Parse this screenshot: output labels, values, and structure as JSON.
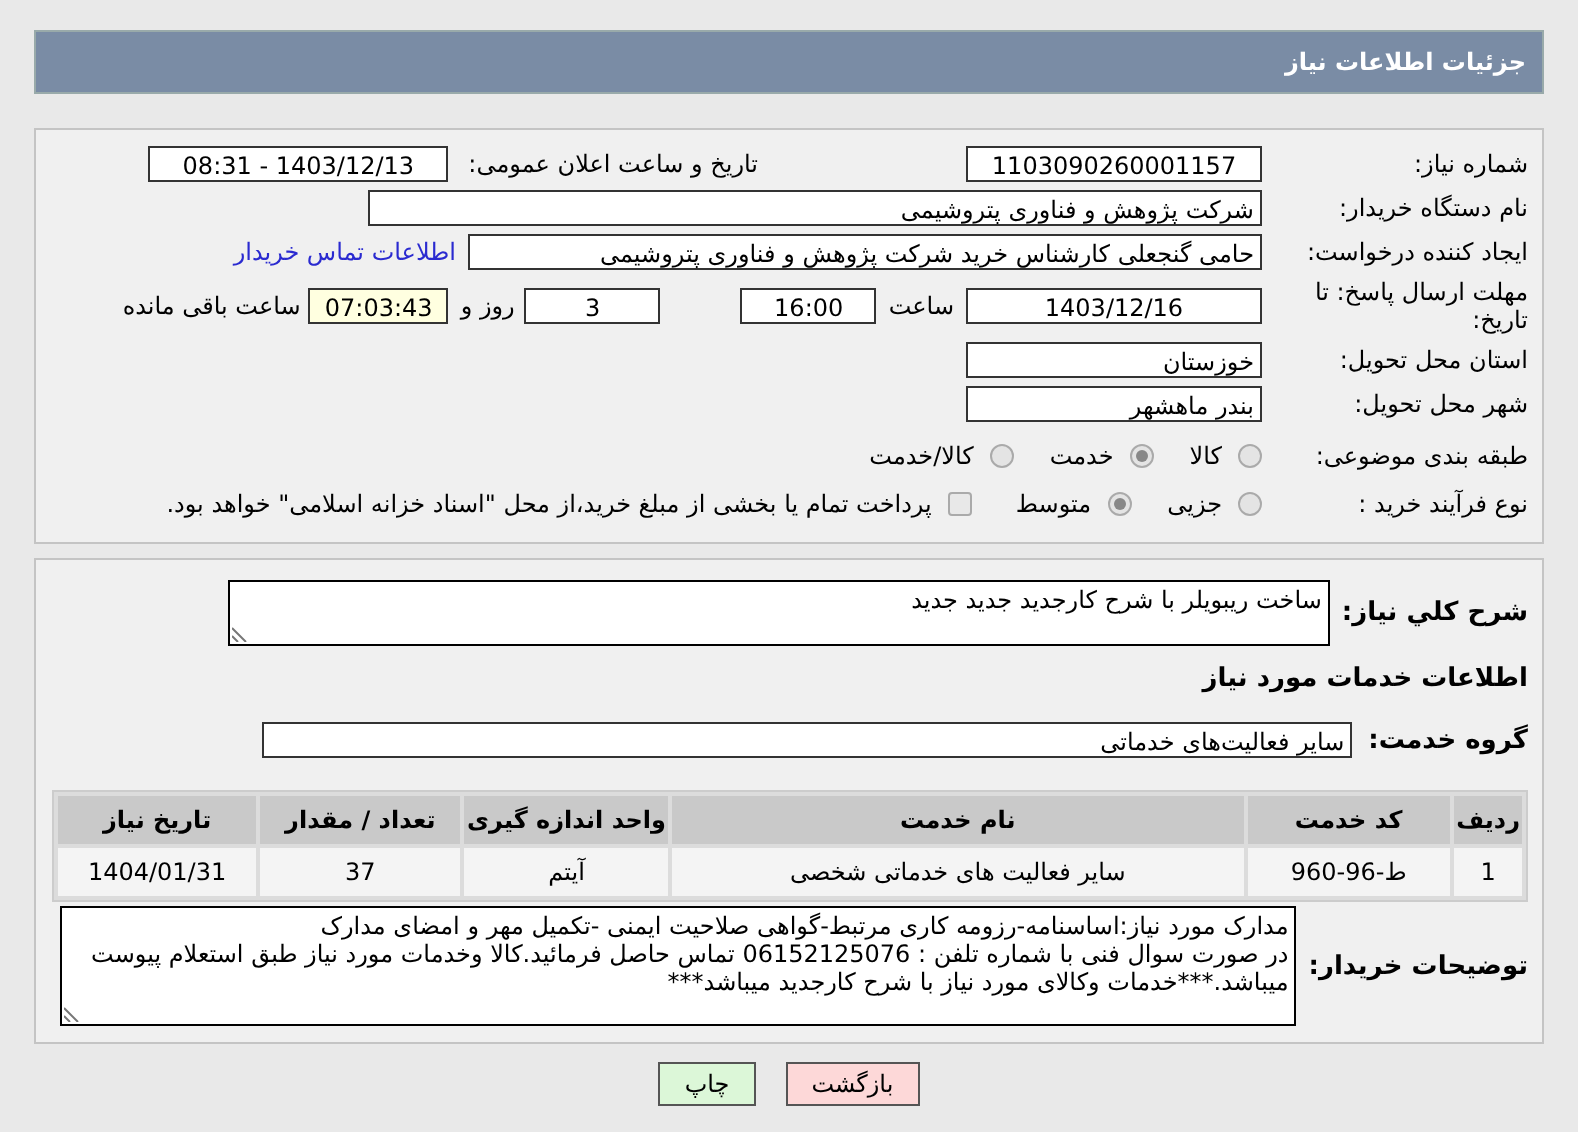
{
  "header": {
    "title": "جزئیات اطلاعات نیاز"
  },
  "details": {
    "need_number": {
      "label": "شماره نیاز:",
      "value": "1103090260001157"
    },
    "announce": {
      "label": "تاریخ و ساعت اعلان عمومی:",
      "value": "1403/12/13 - 08:31"
    },
    "buyer": {
      "label": "نام دستگاه خریدار:",
      "value": "شرکت پژوهش و فناوری پتروشیمی"
    },
    "requester": {
      "label": "ایجاد کننده درخواست:",
      "value": "حامی گنجعلی کارشناس خرید شرکت پژوهش و فناوری پتروشیمی",
      "link": "اطلاعات تماس خریدار"
    },
    "deadline": {
      "label": "مهلت ارسال پاسخ: تا تاریخ:",
      "date": "1403/12/16",
      "time_label": "ساعت",
      "time": "16:00",
      "days": "3",
      "days_label": "روز و",
      "remaining": "07:03:43",
      "remaining_label": "ساعت باقی مانده"
    },
    "province": {
      "label": "استان محل تحویل:",
      "value": "خوزستان"
    },
    "city": {
      "label": "شهر محل تحویل:",
      "value": "بندر ماهشهر"
    },
    "category": {
      "label": "طبقه بندی موضوعی:",
      "options": [
        {
          "label": "کالا",
          "selected": false
        },
        {
          "label": "خدمت",
          "selected": true
        },
        {
          "label": "کالا/خدمت",
          "selected": false
        }
      ]
    },
    "process": {
      "label": "نوع فرآیند خرید :",
      "options": [
        {
          "label": "جزیی",
          "selected": false
        },
        {
          "label": "متوسط",
          "selected": true
        }
      ],
      "payment": {
        "label": "پرداخت تمام یا بخشی از مبلغ خرید،از محل \"اسناد خزانه اسلامی\" خواهد بود.",
        "checked": false
      }
    }
  },
  "services": {
    "description": {
      "label": "شرح کلي نیاز:",
      "value": "ساخت ریبویلر با شرح کارجدید جدید جدید"
    },
    "heading": "اطلاعات خدمات مورد نیاز",
    "group": {
      "label": "گروه خدمت:",
      "value": "سایر فعالیت‌های خدماتی"
    },
    "table": {
      "columns": [
        "ردیف",
        "کد خدمت",
        "نام خدمت",
        "واحد اندازه گیری",
        "تعداد / مقدار",
        "تاریخ نیاز"
      ],
      "rows": [
        [
          "1",
          "ط-96-960",
          "سایر فعالیت های خدماتی شخصی",
          "آیتم",
          "37",
          "1404/01/31"
        ]
      ]
    },
    "notes": {
      "label": "توضیحات خریدار:",
      "lines": [
        "مدارک مورد نیاز:اساسنامه-رزومه کاری مرتبط-گواهی صلاحیت ایمنی -تکمیل مهر و امضای مدارک",
        "در صورت سوال فنی با شماره تلفن : 06152125076 تماس حاصل فرمائید.کالا وخدمات مورد نیاز طبق استعلام پیوست میباشد.***خدمات وکالای مورد نیاز با شرح کارجدید میباشد***"
      ]
    }
  },
  "buttons": [
    {
      "label": "بازگشت",
      "kind": "back"
    },
    {
      "label": "چاپ",
      "kind": "print"
    }
  ]
}
